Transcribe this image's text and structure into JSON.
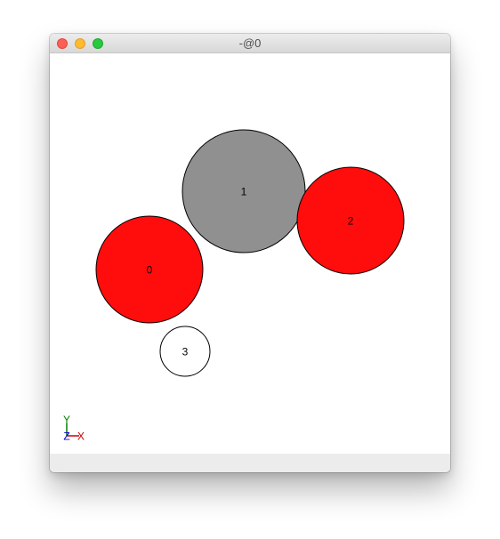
{
  "window": {
    "title": "-@0",
    "controls": {
      "close_color": "#fc5f57",
      "minimize_color": "#fdbb2d",
      "zoom_color": "#28c840"
    }
  },
  "molecule": {
    "atoms": [
      {
        "label": "0",
        "color": "#ff0d0d"
      },
      {
        "label": "1",
        "color": "#909090"
      },
      {
        "label": "2",
        "color": "#ff0d0d"
      },
      {
        "label": "3",
        "color": "#ffffff"
      }
    ]
  },
  "axes": {
    "x": {
      "label": "X",
      "color": "#cc0000"
    },
    "y": {
      "label": "Y",
      "color": "#008000"
    },
    "z": {
      "label": "Z",
      "color": "#0000cc"
    }
  }
}
